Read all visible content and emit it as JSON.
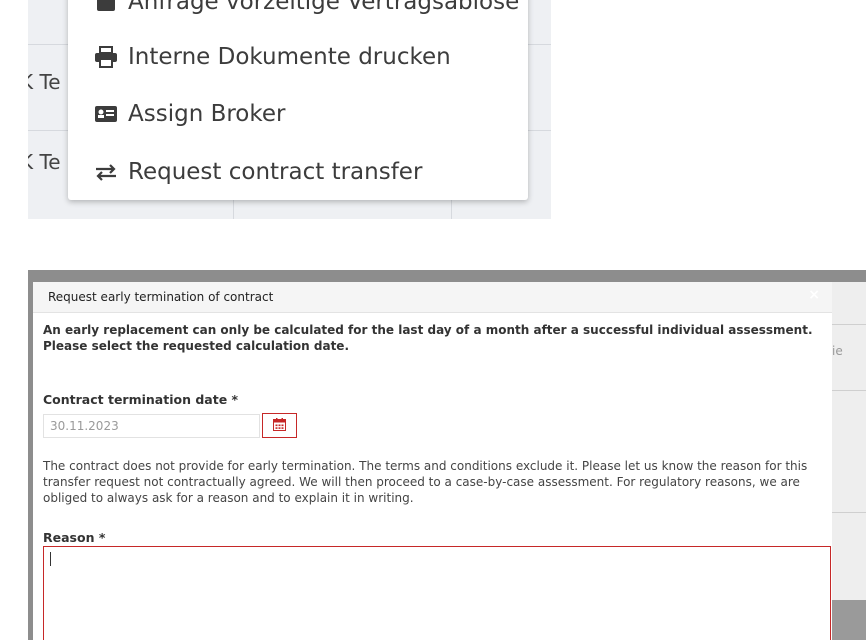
{
  "background_table": {
    "row_text_1": "K Te",
    "row_text_2": "K Te"
  },
  "context_menu": {
    "items": [
      {
        "label": "Anfrage vorzeitige Vertragsablöse",
        "icon": "calculator-icon"
      },
      {
        "label": "Interne Dokumente drucken",
        "icon": "print-icon"
      },
      {
        "label": "Assign Broker",
        "icon": "id-card-icon"
      },
      {
        "label": "Request contract transfer",
        "icon": "exchange-icon"
      }
    ]
  },
  "modal": {
    "title": "Request early termination of contract",
    "close_label": "×",
    "intro_line1": "An early replacement can only be calculated for the last day of a month after a successful individual assessment.",
    "intro_line2": "Please select the requested calculation date.",
    "termination_date_label": "Contract termination date *",
    "termination_date_value": "30.11.2023",
    "notice": "The contract does not provide for early termination. The terms and conditions exclude it. Please let us know the reason for this transfer request not contractually agreed. We will then proceed to a case-by-case assessment. For regulatory reasons, we are obliged to always ask for a reason and to explain it in writing.",
    "reason_label": "Reason *",
    "reason_value": ""
  },
  "background_right_text": "ie",
  "colors": {
    "error_border": "#c62828",
    "overlay": "#8d8d8d",
    "header_bg": "#f5f5f5"
  }
}
